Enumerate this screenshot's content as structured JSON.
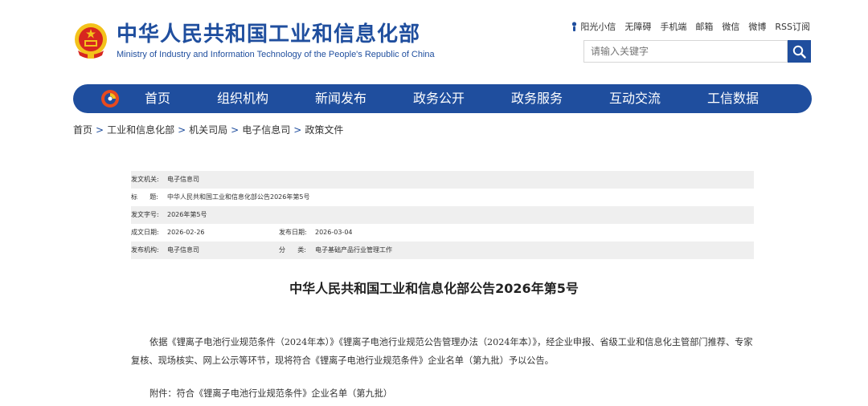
{
  "header": {
    "title": "中华人民共和国工业和信息化部",
    "subtitle": "Ministry of Industry and Information Technology of the People's Republic of China",
    "top_links": [
      "阳光小信",
      "无障碍",
      "手机端",
      "邮箱",
      "微信",
      "微博",
      "RSS订阅"
    ],
    "search_placeholder": "请输入关键字"
  },
  "nav": {
    "items": [
      "首页",
      "组织机构",
      "新闻发布",
      "政务公开",
      "政务服务",
      "互动交流",
      "工信数据"
    ]
  },
  "breadcrumb": [
    "首页",
    "工业和信息化部",
    "机关司局",
    "电子信息司",
    "政策文件"
  ],
  "meta": {
    "issuer_label": "发文机关:",
    "issuer": "电子信息司",
    "title_label": "标      题:",
    "title": "中华人民共和国工业和信息化部公告2026年第5号",
    "number_label": "发文字号:",
    "number": "2026年第5号",
    "created_label": "成文日期:",
    "created": "2026-02-26",
    "published_label": "发布日期:",
    "published": "2026-03-04",
    "agency_label": "发布机构:",
    "agency": "电子信息司",
    "category_label": "分      类:",
    "category": "电子基础产品行业管理工作"
  },
  "content": {
    "title": "中华人民共和国工业和信息化部公告2026年第5号",
    "paragraph1": "依据《锂离子电池行业规范条件（2024年本）》《锂离子电池行业规范公告管理办法（2024年本）》，经企业申报、省级工业和信息化主管部门推荐、专家复核、现场核实、网上公示等环节，现将符合《锂离子电池行业规范条件》企业名单（第九批）予以公告。",
    "attachment": "附件：符合《锂离子电池行业规范条件》企业名单（第九批）"
  },
  "colors": {
    "brand": "#1f4e9e",
    "emblem_red": "#d7261f",
    "emblem_gold": "#f3c21b"
  }
}
